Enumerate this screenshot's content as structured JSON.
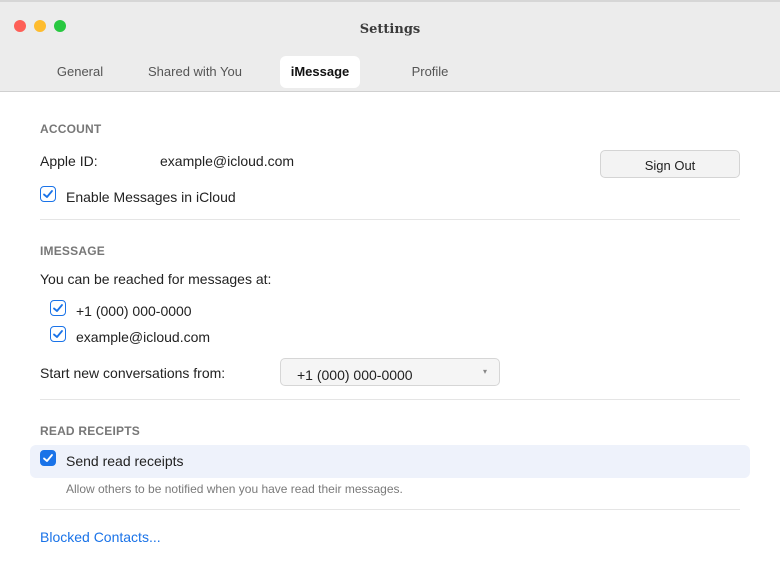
{
  "window": {
    "title": "Settings"
  },
  "tabs": [
    {
      "label": "General",
      "active": false
    },
    {
      "label": "Shared with You",
      "active": false
    },
    {
      "label": "iMessage",
      "active": true
    },
    {
      "label": "Profile",
      "active": false
    }
  ],
  "account": {
    "section_title": "ACCOUNT",
    "apple_id_label": "Apple ID:",
    "apple_id_value": "example@icloud.com",
    "sign_out_label": "Sign Out",
    "enable_icloud_label": "Enable Messages in iCloud",
    "enable_icloud_checked": true
  },
  "imessage": {
    "section_title": "IMESSAGE",
    "reach_label": "You can be reached for messages at:",
    "addresses": [
      {
        "value": "+1 (000) 000-0000",
        "checked": true
      },
      {
        "value": "example@icloud.com",
        "checked": true
      }
    ],
    "start_from_label": "Start new conversations from:",
    "start_from_value": "+1 (000) 000-0000"
  },
  "read_receipts": {
    "section_title": "READ RECEIPTS",
    "send_label": "Send read receipts",
    "send_checked": true,
    "hint": "Allow others to be notified when you have read their messages."
  },
  "blocked_contacts_label": "Blocked Contacts...",
  "colors": {
    "accent": "#1a73e8",
    "close": "#fe5f57",
    "minimize": "#febc2e",
    "maximize": "#28c840"
  }
}
